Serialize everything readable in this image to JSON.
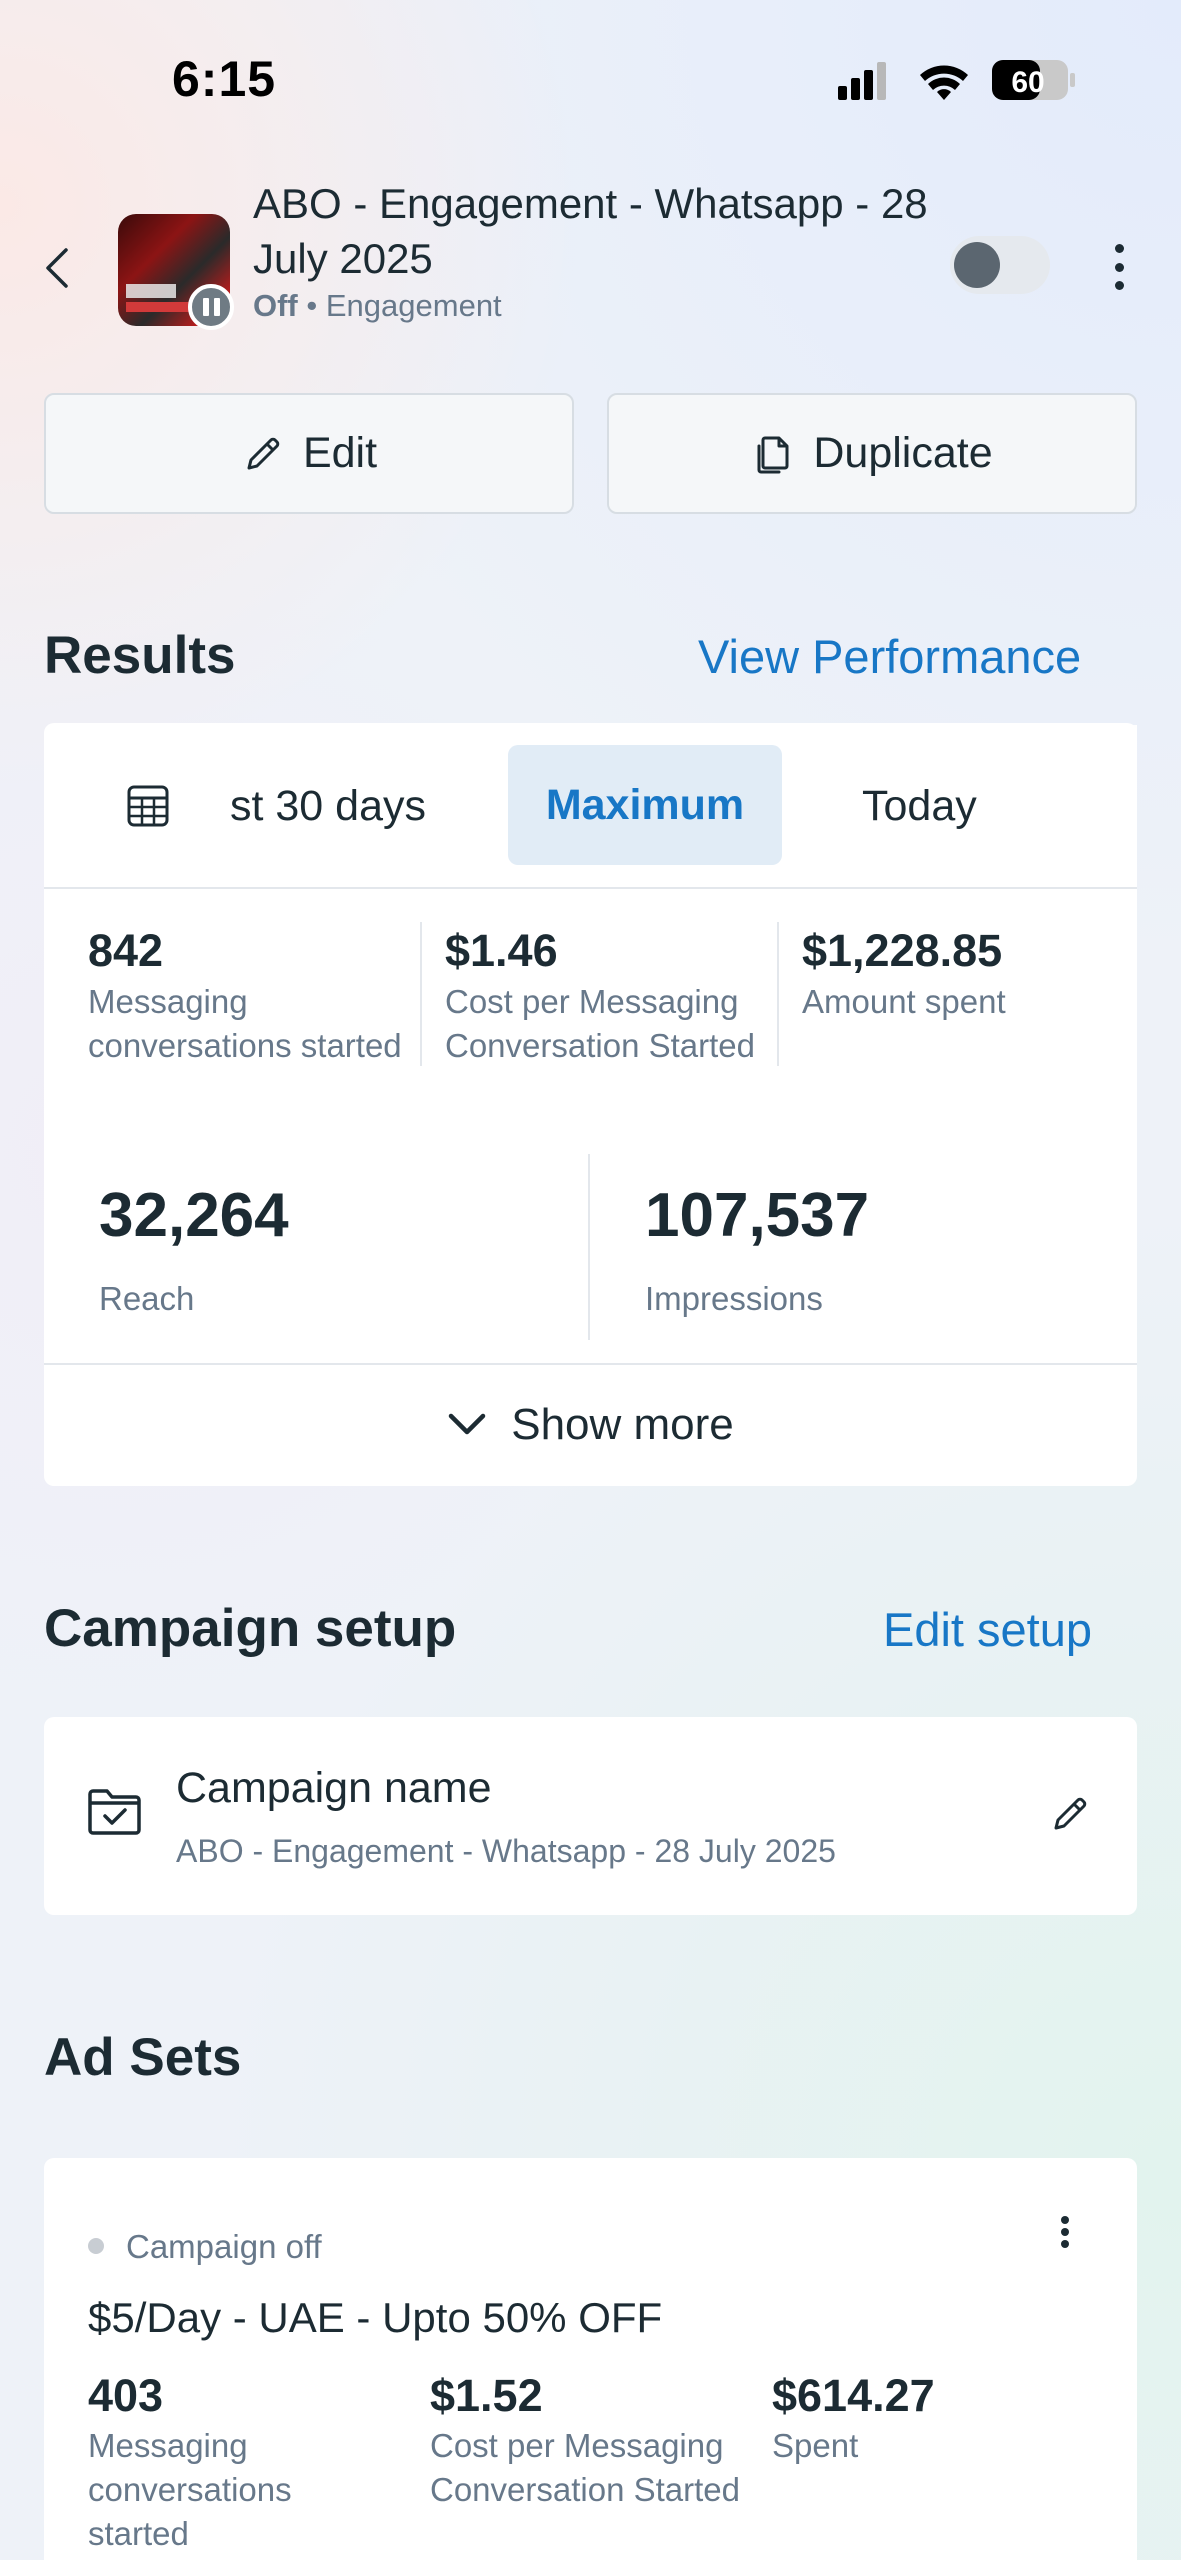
{
  "status_bar": {
    "time": "6:15",
    "battery": "60"
  },
  "header": {
    "title": "ABO - Engagement - Whatsapp - 28 July 2025",
    "status": "Off",
    "separator": "•",
    "objective": "Engagement",
    "toggle_on": false
  },
  "actions": {
    "edit_label": "Edit",
    "duplicate_label": "Duplicate"
  },
  "results": {
    "heading": "Results",
    "link": "View Performance",
    "date_tabs": [
      {
        "label": "st 30 days",
        "selected": false
      },
      {
        "label": "Maximum",
        "selected": true
      },
      {
        "label": "Today",
        "selected": false
      }
    ],
    "metrics": [
      {
        "value": "842",
        "label": "Messaging conversations started"
      },
      {
        "value": "$1.46",
        "label": "Cost per Messaging Conversation Started"
      },
      {
        "value": "$1,228.85",
        "label": "Amount spent"
      }
    ],
    "reach": {
      "value": "32,264",
      "label": "Reach"
    },
    "impressions": {
      "value": "107,537",
      "label": "Impressions"
    },
    "show_more": "Show more"
  },
  "campaign_setup": {
    "heading": "Campaign setup",
    "link": "Edit setup",
    "name_label": "Campaign name",
    "name_value": "ABO - Engagement - Whatsapp - 28 July 2025"
  },
  "ad_sets": {
    "heading": "Ad Sets",
    "items": [
      {
        "status": "Campaign off",
        "name": "$5/Day - UAE - Upto 50% OFF",
        "metrics": [
          {
            "value": "403",
            "label": "Messaging conversations started"
          },
          {
            "value": "$1.52",
            "label": "Cost per Messaging Conversation Started"
          },
          {
            "value": "$614.27",
            "label": "Spent"
          }
        ]
      }
    ]
  },
  "colors": {
    "accent": "#1877c6",
    "text": "#1c2b33",
    "muted": "#67788a",
    "selected_tab_bg": "#e1ecf6"
  }
}
